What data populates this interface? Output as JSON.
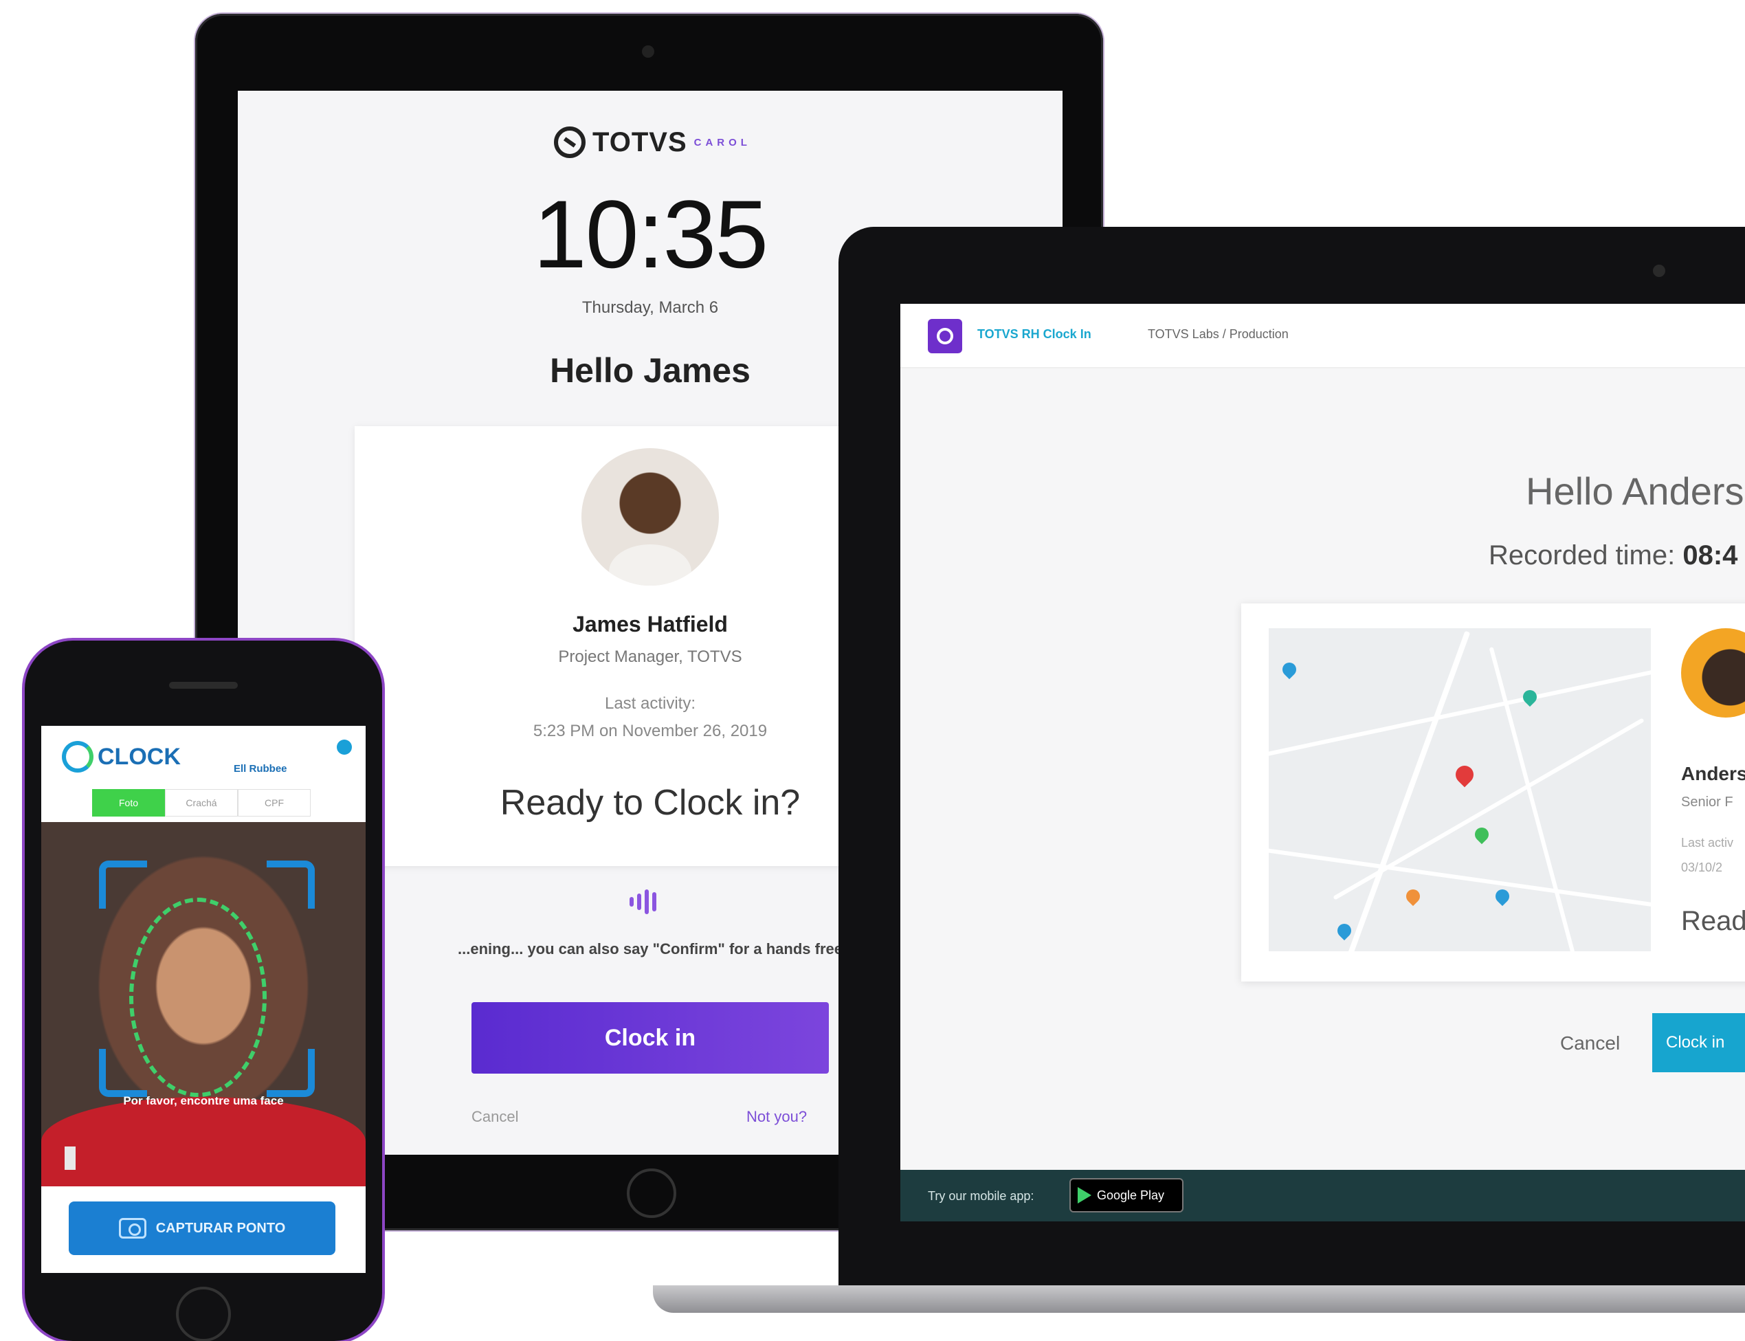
{
  "tablet": {
    "brand": "TOTVS",
    "brand_sub": "CAROL",
    "time": "10:35",
    "date": "Thursday, March 6",
    "greeting": "Hello James",
    "employee_name": "James Hatfield",
    "employee_role": "Project Manager, TOTVS",
    "last_activity_label": "Last activity:",
    "last_activity_value": "5:23 PM on November 26, 2019",
    "prompt": "Ready to Clock in?",
    "voice_hint": "...ening... you can also say \"Confirm\" for a hands free",
    "clock_in_button": "Clock in",
    "cancel_link": "Cancel",
    "not_you_link": "Not you?"
  },
  "laptop": {
    "app_name": "TOTVS RH Clock In",
    "breadcrumb": "TOTVS Labs / Production",
    "greeting": "Hello Anders",
    "recorded_label": "Recorded time:",
    "recorded_value": "08:4",
    "employee_name": "Anders",
    "employee_role": "Senior F",
    "last_activity_label": "Last activ",
    "last_activity_value": "03/10/2",
    "prompt": "Read",
    "cancel_button": "Cancel",
    "clock_in_button": "Clock in",
    "footer_text": "Try our mobile app:",
    "google_play": "Google Play"
  },
  "phone": {
    "app_name": "CLOCK",
    "user_label": "Ell Rubbee",
    "tabs": [
      {
        "label": "Foto",
        "active": true
      },
      {
        "label": "Crachá",
        "active": false
      },
      {
        "label": "CPF",
        "active": false
      }
    ],
    "camera_instruction": "Por favor, encontre uma face",
    "capture_button": "CAPTURAR PONTO"
  },
  "colors": {
    "tablet_primary": "#7c45dd",
    "laptop_primary": "#17a5cf",
    "phone_primary": "#1b7fd2",
    "phone_active_tab": "#3fd14a"
  }
}
